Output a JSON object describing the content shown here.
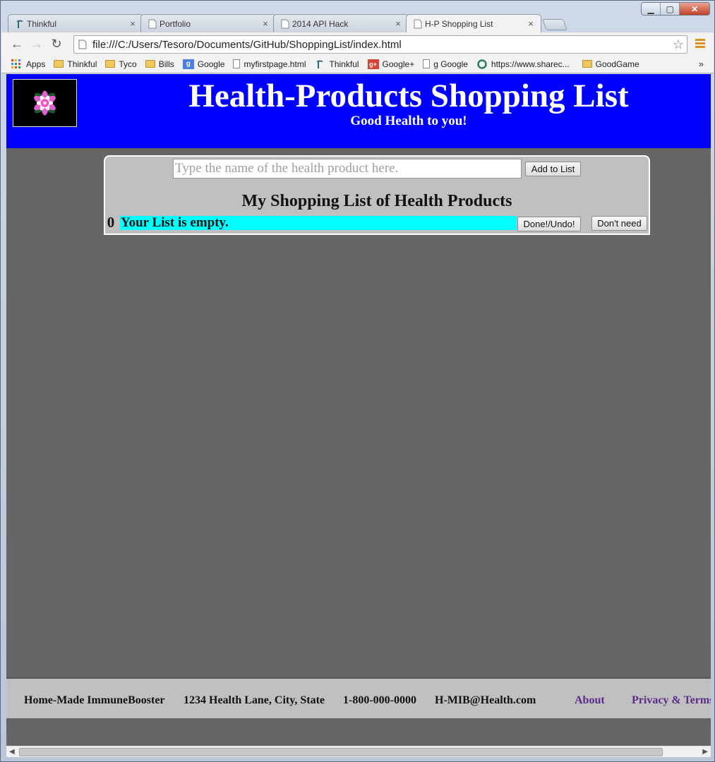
{
  "browser": {
    "window_controls": {
      "minimize": "▁",
      "maximize": "▢",
      "close": "✕"
    },
    "tabs": [
      {
        "title": "Thinkful",
        "icon": "thinkful-icon",
        "active": false
      },
      {
        "title": "Portfolio",
        "icon": "page-icon",
        "active": false
      },
      {
        "title": "2014 API Hack",
        "icon": "page-icon",
        "active": false
      },
      {
        "title": "H-P Shopping List",
        "icon": "page-icon",
        "active": true
      }
    ],
    "tab_close": "×",
    "nav": {
      "back": "←",
      "forward": "→",
      "reload": "↻"
    },
    "url": "file:///C:/Users/Tesoro/Documents/GitHub/ShoppingList/index.html",
    "star": "☆",
    "bookmarks": [
      {
        "label": "Apps",
        "icon": "apps-icon"
      },
      {
        "label": "Thinkful",
        "icon": "folder-icon"
      },
      {
        "label": "Tyco",
        "icon": "folder-icon"
      },
      {
        "label": "Bills",
        "icon": "folder-icon"
      },
      {
        "label": "Google",
        "icon": "google-icon"
      },
      {
        "label": "myfirstpage.html",
        "icon": "page-icon"
      },
      {
        "label": "Thinkful",
        "icon": "thinkful-icon"
      },
      {
        "label": "Google+",
        "icon": "google-plus-icon"
      },
      {
        "label": "g Google",
        "icon": "page-icon"
      },
      {
        "label": "https://www.sharec...",
        "icon": "sharecare-icon"
      },
      {
        "label": "GoodGame",
        "icon": "folder-icon"
      }
    ],
    "bookmarks_more": "»"
  },
  "page": {
    "header": {
      "title": "Health-Products Shopping List",
      "subtitle": "Good Health to you!"
    },
    "form": {
      "input_placeholder": "Type the name of the health product here.",
      "input_value": "",
      "add_button": "Add to List"
    },
    "list": {
      "title": "My Shopping List of Health Products",
      "rows": [
        {
          "count": "0",
          "text": "Your List is empty.",
          "done_button": "Done!/Undo!",
          "remove_button": "Don't need"
        }
      ]
    },
    "footer": {
      "company": "Home-Made ImmuneBooster",
      "address": "1234 Health Lane, City, State",
      "phone": "1-800-000-0000",
      "email": "H-MIB@Health.com",
      "about": "About",
      "privacy": "Privacy & Terms"
    }
  }
}
